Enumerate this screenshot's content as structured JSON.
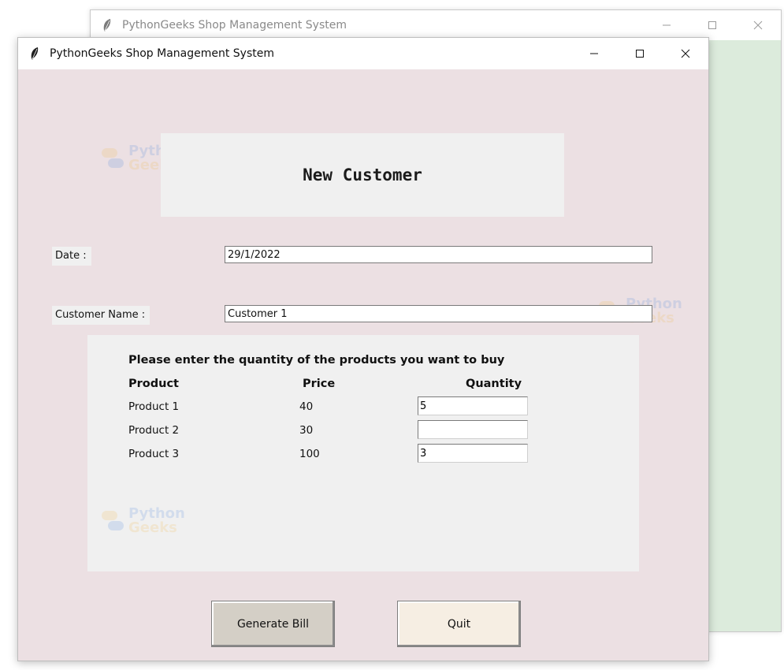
{
  "back_window": {
    "title": "PythonGeeks Shop Management System"
  },
  "window": {
    "title": "PythonGeeks Shop Management System",
    "icon": "feather-icon"
  },
  "header": {
    "title": "New Customer"
  },
  "form": {
    "date_label": "Date :",
    "date_value": "29/1/2022",
    "customer_label": "Customer Name :",
    "customer_value": "Customer 1"
  },
  "products": {
    "instruction": "Please enter the quantity of the products you want to buy",
    "columns": [
      "Product",
      "Price",
      "Quantity"
    ],
    "rows": [
      {
        "name": "Product 1",
        "price": "40",
        "quantity": "5"
      },
      {
        "name": "Product 2",
        "price": "30",
        "quantity": ""
      },
      {
        "name": "Product 3",
        "price": "100",
        "quantity": "3"
      }
    ]
  },
  "buttons": {
    "generate_bill": "Generate Bill",
    "quit": "Quit"
  },
  "watermark": {
    "line1": "Python",
    "line2": "Geeks"
  },
  "colors": {
    "front_background": "#ece0e3",
    "back_background": "#dcebdc",
    "frame_background": "#f0f0f0",
    "generate_button": "#d4cfc6",
    "quit_button": "#f6eee3"
  }
}
